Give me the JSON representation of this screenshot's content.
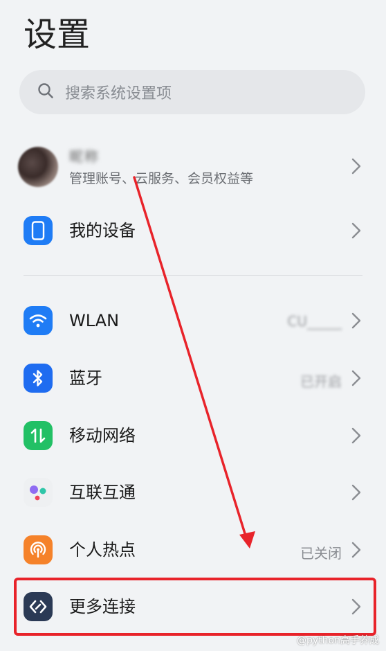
{
  "header": {
    "title": "设置"
  },
  "search": {
    "placeholder": "搜索系统设置项"
  },
  "account": {
    "name": "昵称",
    "subtitle": "管理账号、云服务、会员权益等"
  },
  "rows": {
    "my_device": {
      "label": "我的设备",
      "icon": "phone-icon",
      "color": "#1f7cf5"
    },
    "wlan": {
      "label": "WLAN",
      "value": "CU_____",
      "icon": "wifi-icon",
      "color": "#1f7cf5"
    },
    "bluetooth": {
      "label": "蓝牙",
      "value": "已开启",
      "icon": "bluetooth-icon",
      "color": "#1f6cf0"
    },
    "mobile_network": {
      "label": "移动网络",
      "icon": "mobile-data-icon",
      "color": "#22c065"
    },
    "interconnect": {
      "label": "互联互通",
      "icon": "interconnect-icon",
      "color": "#eef0f2"
    },
    "hotspot": {
      "label": "个人热点",
      "value": "已关闭",
      "icon": "hotspot-icon",
      "color": "#f5822a"
    },
    "more_connections": {
      "label": "更多连接",
      "icon": "more-connections-icon",
      "color": "#2b3a55"
    }
  },
  "annotation": {
    "highlight_color": "#e8232a"
  },
  "watermark": {
    "text": "@python高手养成"
  }
}
